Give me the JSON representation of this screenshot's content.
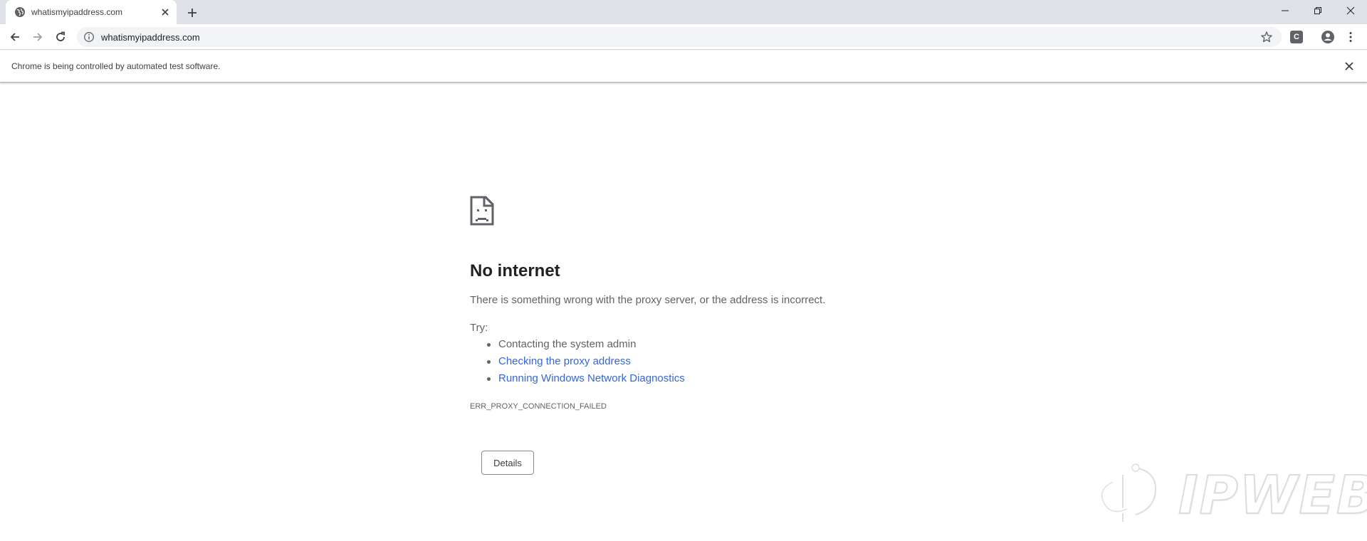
{
  "tab": {
    "title": "whatismyipaddress.com"
  },
  "omnibox": {
    "url": "whatismyipaddress.com"
  },
  "extension": {
    "letter": "C"
  },
  "infobar": {
    "message": "Chrome is being controlled by automated test software."
  },
  "error_page": {
    "heading": "No internet",
    "summary": "There is something wrong with the proxy server, or the address is incorrect.",
    "try_label": "Try:",
    "suggestions": [
      {
        "text": "Contacting the system admin",
        "is_link": false
      },
      {
        "text": "Checking the proxy address",
        "is_link": true
      },
      {
        "text": "Running Windows Network Diagnostics",
        "is_link": true
      }
    ],
    "error_code": "ERR_PROXY_CONNECTION_FAILED",
    "details_label": "Details"
  },
  "watermark": {
    "text": "IPWEB"
  },
  "icons": {
    "favicon": "globe-icon",
    "tab_close": "close-icon",
    "new_tab": "plus-icon",
    "back": "arrow-left-icon",
    "forward": "arrow-right-icon",
    "reload": "reload-icon",
    "site_info": "info-icon",
    "bookmark": "star-icon",
    "profile": "account-circle-icon",
    "menu": "kebab-menu-icon",
    "error": "sad-page-icon"
  },
  "colors": {
    "tabstrip_bg": "#dee1e6",
    "omnibox_bg": "#f1f3f4",
    "link": "#3367d6",
    "body_text": "#5f6368",
    "heading_text": "#202124"
  }
}
